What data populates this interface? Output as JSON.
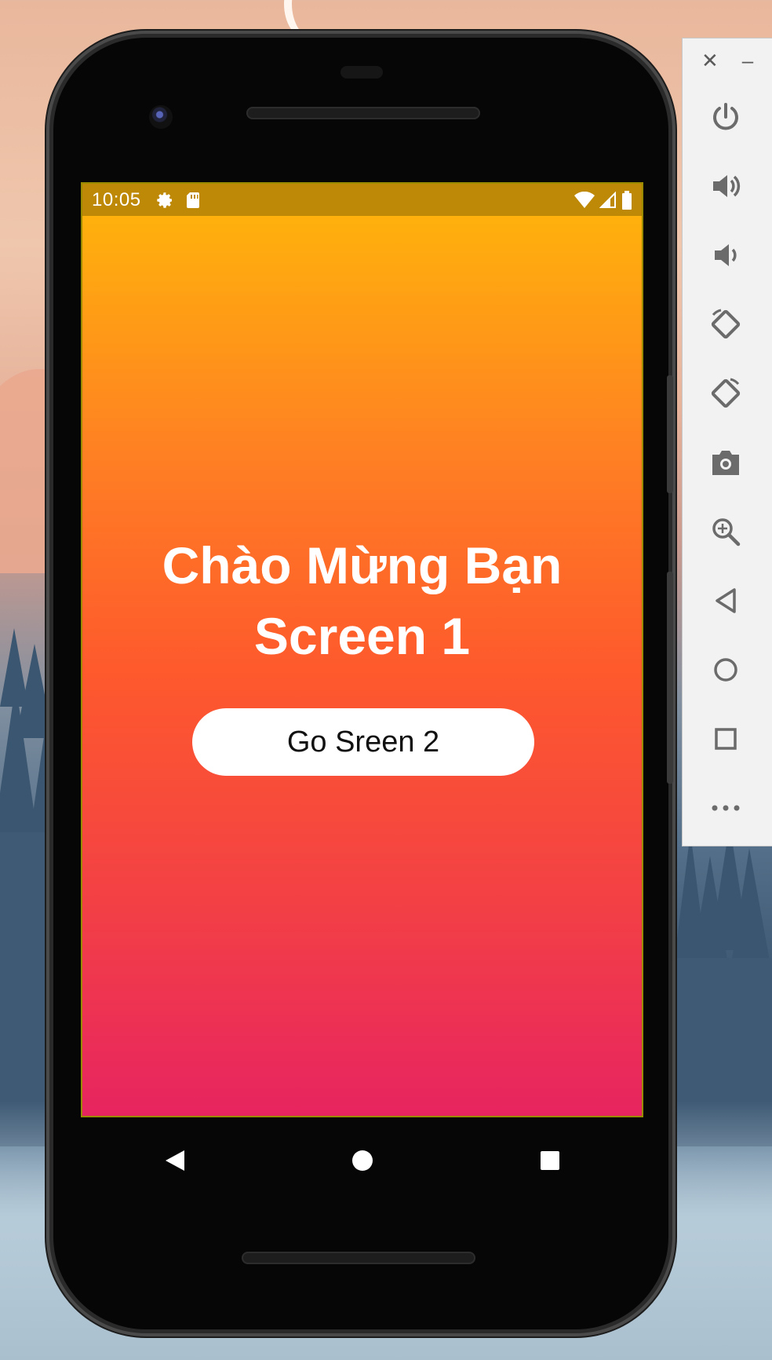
{
  "status_bar": {
    "time": "10:05",
    "color": "#bd8906",
    "icons": [
      "settings-icon",
      "sd-card-icon",
      "wifi-icon",
      "signal-icon",
      "battery-icon"
    ]
  },
  "app": {
    "title_line1": "Chào Mừng Bạn",
    "title_line2": "Screen 1",
    "button_label": "Go Sreen 2",
    "gradient": [
      "#ffb10c",
      "#fe5a2c",
      "#e72460"
    ]
  },
  "nav_bar": {
    "icons": [
      "back-icon",
      "home-icon",
      "recents-icon"
    ]
  },
  "emulator_toolbar": {
    "window_controls": [
      "close-icon",
      "minimize-icon"
    ],
    "items": [
      "power-icon",
      "volume-up-icon",
      "volume-down-icon",
      "rotate-left-icon",
      "rotate-right-icon",
      "camera-icon",
      "zoom-icon",
      "back-icon",
      "home-icon",
      "overview-icon",
      "more-icon"
    ]
  }
}
